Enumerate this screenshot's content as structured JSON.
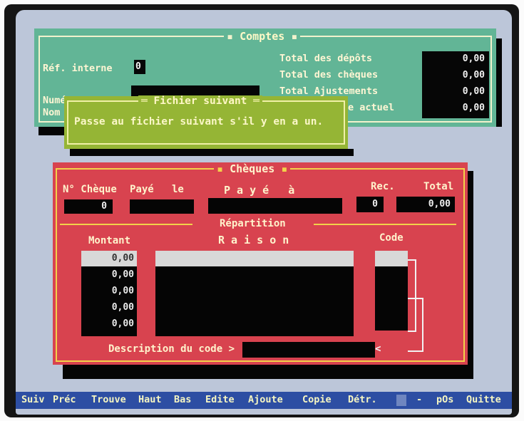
{
  "comptes": {
    "title": "Comptes",
    "ref_label": "Réf. interne",
    "ref_value": "0",
    "numero_label": "Numéro Compte",
    "nom_label": "Nom",
    "total_depots_label": "Total des dépôts",
    "total_cheques_label": "Total des chèques",
    "total_ajust_label": "Total Ajustements",
    "solde_label": "e actuel",
    "total_depots": "0,00",
    "total_cheques": "0,00",
    "total_ajust": "0,00",
    "solde": "0,00"
  },
  "popup": {
    "title": "Fichier suivant",
    "message": "Passe au fichier suivant s'il y en a un."
  },
  "cheques": {
    "title": "Chèques",
    "no_cheque_label": "N° Chèque",
    "paye_le_label": "Payé   le",
    "paye_a_label": "P a y é   à",
    "rec_label": "Rec.",
    "total_label": "Total",
    "no_cheque_value": "0",
    "rec_value": "0",
    "total_value": "0,00",
    "repartition_label": "Répartition",
    "montant_label": "Montant",
    "raison_label": "R a i s o n",
    "code_label": "Code",
    "montants": [
      "0,00",
      "0,00",
      "0,00",
      "0,00",
      "0,00"
    ],
    "description_label": "Description du code >",
    "description_arrow": "<"
  },
  "function_bar": {
    "items": [
      "Suiv",
      "Préc",
      "Trouve",
      "Haut",
      "Bas",
      "Edite",
      "Ajoute",
      "Copie",
      "Détr.",
      "-",
      "pOs",
      "Quitte"
    ]
  },
  "colors": {
    "comptes_bg": "#62b596",
    "popup_bg": "#95b535",
    "cheques_bg": "#d8434f",
    "screen_bg": "#bcc6d9",
    "function_bar_bg": "#2d4ea3"
  }
}
